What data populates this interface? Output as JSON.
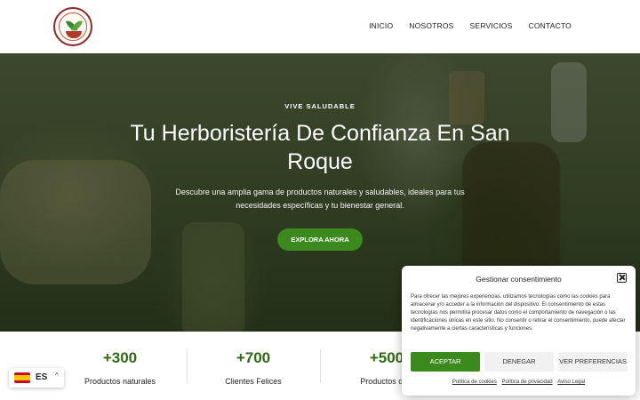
{
  "nav": {
    "items": [
      "INICIO",
      "NOSOTROS",
      "SERVICIOS",
      "CONTACTO"
    ]
  },
  "hero": {
    "kicker": "VIVE SALUDABLE",
    "title": "Tu Herboristería De Confianza En San Roque",
    "subtitle": "Descubre una amplia gama de productos naturales y saludables, ideales para tus necesidades específicas y tu bienestar general.",
    "button": "EXPLORA AHORA"
  },
  "stats": [
    {
      "number": "+300",
      "label": "Productos naturales"
    },
    {
      "number": "+700",
      "label": "Clientes Felices"
    },
    {
      "number": "+500",
      "label": "Productos disp"
    }
  ],
  "language": {
    "code": "ES",
    "caret": "^",
    "flag": "spain-flag-icon"
  },
  "consent": {
    "title": "Gestionar consentimiento",
    "text": "Para ofrecer las mejores experiencias, utilizamos tecnologías como las cookies para almacenar y/o acceder a la información del dispositivo. El consentimiento de estas tecnologías nos permitirá procesar datos como el comportamiento de navegación o las identificaciones únicas en este sitio. No consentir o retirar el consentimiento, puede afectar negativamente a ciertas características y funciones.",
    "accept": "ACEPTAR",
    "deny": "DENEGAR",
    "prefs": "VER PREFERENCIAS",
    "links": [
      "Política de cookies",
      "Política de privacidad",
      "Aviso Legal"
    ]
  },
  "colors": {
    "accent": "#3c8a1e",
    "stat_number": "#2f6a12"
  }
}
